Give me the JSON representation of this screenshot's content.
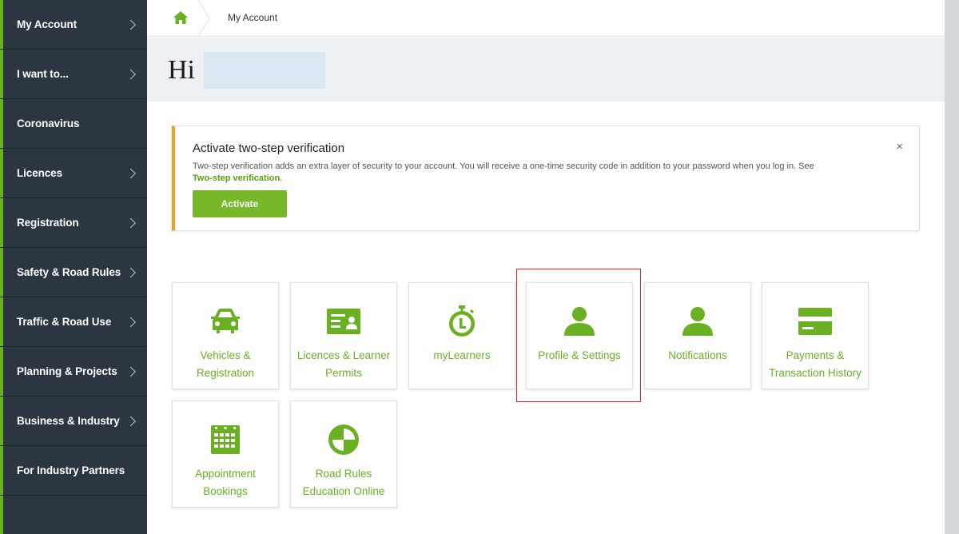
{
  "sidebar": {
    "items": [
      {
        "label": "My Account",
        "chevron": true
      },
      {
        "label": "I want to...",
        "chevron": true
      },
      {
        "label": "Coronavirus",
        "chevron": false
      },
      {
        "label": "Licences",
        "chevron": true
      },
      {
        "label": "Registration",
        "chevron": true
      },
      {
        "label": "Safety & Road Rules",
        "chevron": true
      },
      {
        "label": "Traffic & Road Use",
        "chevron": true
      },
      {
        "label": "Planning & Projects",
        "chevron": true
      },
      {
        "label": "Business & Industry",
        "chevron": true
      },
      {
        "label": "For Industry Partners",
        "chevron": false
      }
    ]
  },
  "breadcrumb": {
    "home_icon": "home-icon",
    "current": "My Account"
  },
  "greeting": {
    "hi": "Hi",
    "name": ""
  },
  "alert": {
    "title": "Activate two-step verification",
    "text": "Two-step verification adds an extra layer of security to your account. You will receive a one-time security code in addition to your password when you log in. See",
    "link": "Two-step verification",
    "link_suffix": ".",
    "button": "Activate",
    "close": "×",
    "accent_color": "#f0a020"
  },
  "tiles": [
    {
      "line1": "Vehicles &",
      "line2": "Registration",
      "icon": "car-icon"
    },
    {
      "line1": "Licences & Learner",
      "line2": "Permits",
      "icon": "id-card-icon"
    },
    {
      "line1": "myLearners",
      "line2": "",
      "icon": "stopwatch-icon"
    },
    {
      "line1": "Profile & Settings",
      "line2": "",
      "icon": "person-icon"
    },
    {
      "line1": "Notifications",
      "line2": "",
      "icon": "person-icon"
    },
    {
      "line1": "Payments &",
      "line2": "Transaction History",
      "icon": "credit-card-icon"
    },
    {
      "line1": "Appointment",
      "line2": "Bookings",
      "icon": "calendar-icon"
    },
    {
      "line1": "Road Rules",
      "line2": "Education Online",
      "icon": "checkered-circle-icon"
    }
  ],
  "colors": {
    "brand_green": "#6ab023",
    "sidebar_bg": "#2c3640",
    "highlight_red": "#e0202a"
  }
}
